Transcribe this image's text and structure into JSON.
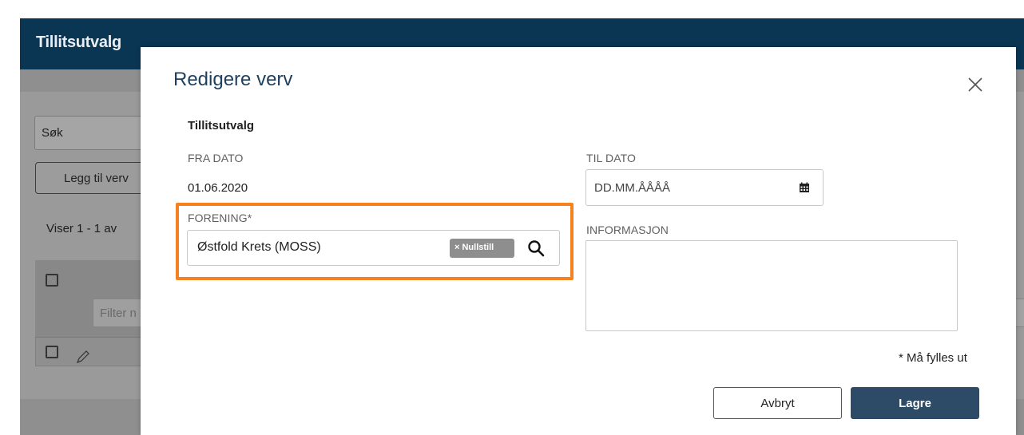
{
  "background": {
    "header_title": "Tillitsutvalg",
    "search_label": "Søk",
    "add_button_label": "Legg til verv",
    "viser_text": "Viser 1 - 1 av",
    "filter_placeholder": "Filter n"
  },
  "modal": {
    "title": "Redigere verv",
    "section_title": "Tillitsutvalg",
    "fra_dato": {
      "label": "FRA DATO",
      "value": "01.06.2020"
    },
    "til_dato": {
      "label": "TIL DATO",
      "placeholder": "DD.MM.ÅÅÅÅ"
    },
    "forening": {
      "label": "FORENING*",
      "value": "Østfold Krets (MOSS)",
      "reset_label": "× Nullstill"
    },
    "informasjon": {
      "label": "INFORMASJON"
    },
    "required_note": "* Må fylles ut",
    "cancel_label": "Avbryt",
    "save_label": "Lagre"
  },
  "colors": {
    "header_bg": "#0a3553",
    "title_color": "#1e3f5e",
    "save_button_bg": "#2d4a66",
    "highlight": "#f5821f",
    "reset_badge_bg": "#8e8e8e"
  },
  "icons": {
    "close": "close-icon",
    "calendar": "calendar-icon",
    "search": "search-icon",
    "pencil": "pencil-icon"
  }
}
